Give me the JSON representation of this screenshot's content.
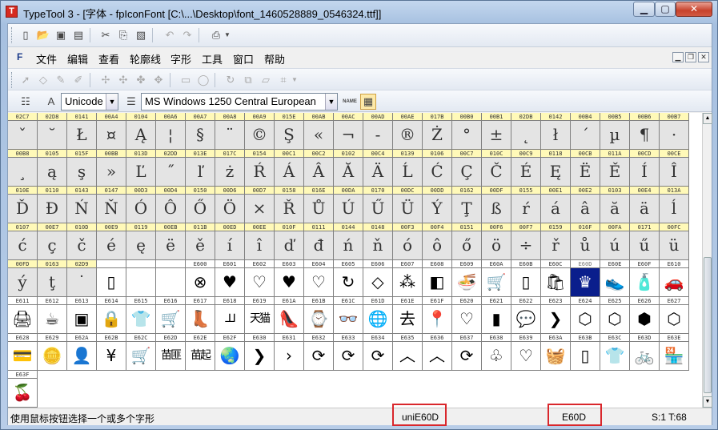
{
  "window": {
    "title": "TypeTool 3 - [字体 - fpIconFont [C:\\...\\Desktop\\font_1460528889_0546324.ttf]]",
    "app_icon": "typetool-app-icon",
    "minimize_icon": "minimize-icon",
    "maximize_icon": "maximize-icon",
    "close_icon": "close-icon"
  },
  "menu": {
    "items": [
      "文件",
      "编辑",
      "查看",
      "轮廓线",
      "字形",
      "工具",
      "窗口",
      "帮助"
    ]
  },
  "toolbar": {
    "encoding_value": "Unicode",
    "codepage_value": "MS Windows 1250 Central European",
    "name_button_label": "NAME"
  },
  "glyph_grid": {
    "rows": [
      [
        [
          "02C7",
          "ˇ"
        ],
        [
          "02D8",
          "˘"
        ],
        [
          "0141",
          "Ł"
        ],
        [
          "00A4",
          "¤"
        ],
        [
          "0104",
          "Ą"
        ],
        [
          "00A6",
          "¦"
        ],
        [
          "00A7",
          "§"
        ],
        [
          "00A8",
          "¨"
        ],
        [
          "00A9",
          "©"
        ],
        [
          "015E",
          "Ş"
        ],
        [
          "00AB",
          "«"
        ],
        [
          "00AC",
          "¬"
        ],
        [
          "00AD",
          "-"
        ],
        [
          "00AE",
          "®"
        ],
        [
          "017B",
          "Ż"
        ],
        [
          "00B0",
          "°"
        ],
        [
          "00B1",
          "±"
        ],
        [
          "02DB",
          "˛"
        ],
        [
          "0142",
          "ł"
        ],
        [
          "00B4",
          "´"
        ],
        [
          "00B5",
          "µ"
        ],
        [
          "00B6",
          "¶"
        ],
        [
          "00B7",
          "·"
        ]
      ],
      [
        [
          "00B8",
          "¸"
        ],
        [
          "0105",
          "ą"
        ],
        [
          "015F",
          "ş"
        ],
        [
          "00BB",
          "»"
        ],
        [
          "013D",
          "Ľ"
        ],
        [
          "02DD",
          "˝"
        ],
        [
          "013E",
          "ľ"
        ],
        [
          "017C",
          "ż"
        ],
        [
          "0154",
          "Ŕ"
        ],
        [
          "00C1",
          "Á"
        ],
        [
          "00C2",
          "Â"
        ],
        [
          "0102",
          "Ă"
        ],
        [
          "00C4",
          "Ä"
        ],
        [
          "0139",
          "Ĺ"
        ],
        [
          "0106",
          "Ć"
        ],
        [
          "00C7",
          "Ç"
        ],
        [
          "010C",
          "Č"
        ],
        [
          "00C9",
          "É"
        ],
        [
          "0118",
          "Ę"
        ],
        [
          "00CB",
          "Ë"
        ],
        [
          "011A",
          "Ě"
        ],
        [
          "00CD",
          "Í"
        ],
        [
          "00CE",
          "Î"
        ]
      ],
      [
        [
          "010E",
          "Ď"
        ],
        [
          "0110",
          "Đ"
        ],
        [
          "0143",
          "Ń"
        ],
        [
          "0147",
          "Ň"
        ],
        [
          "00D3",
          "Ó"
        ],
        [
          "00D4",
          "Ô"
        ],
        [
          "0150",
          "Ő"
        ],
        [
          "00D6",
          "Ö"
        ],
        [
          "00D7",
          "×"
        ],
        [
          "0158",
          "Ř"
        ],
        [
          "016E",
          "Ů"
        ],
        [
          "00DA",
          "Ú"
        ],
        [
          "0170",
          "Ű"
        ],
        [
          "00DC",
          "Ü"
        ],
        [
          "00DD",
          "Ý"
        ],
        [
          "0162",
          "Ţ"
        ],
        [
          "00DF",
          "ß"
        ],
        [
          "0155",
          "ŕ"
        ],
        [
          "00E1",
          "á"
        ],
        [
          "00E2",
          "â"
        ],
        [
          "0103",
          "ă"
        ],
        [
          "00E4",
          "ä"
        ],
        [
          "013A",
          "ĺ"
        ]
      ],
      [
        [
          "0107",
          "ć"
        ],
        [
          "00E7",
          "ç"
        ],
        [
          "010D",
          "č"
        ],
        [
          "00E9",
          "é"
        ],
        [
          "0119",
          "ę"
        ],
        [
          "00EB",
          "ë"
        ],
        [
          "011B",
          "ě"
        ],
        [
          "00ED",
          "í"
        ],
        [
          "00EE",
          "î"
        ],
        [
          "010F",
          "ď"
        ],
        [
          "0111",
          "đ"
        ],
        [
          "0144",
          "ń"
        ],
        [
          "0148",
          "ň"
        ],
        [
          "00F3",
          "ó"
        ],
        [
          "00F4",
          "ô"
        ],
        [
          "0151",
          "ő"
        ],
        [
          "00F6",
          "ö"
        ],
        [
          "00F7",
          "÷"
        ],
        [
          "0159",
          "ř"
        ],
        [
          "016F",
          "ů"
        ],
        [
          "00FA",
          "ú"
        ],
        [
          "0171",
          "ű"
        ],
        [
          "00FC",
          "ü"
        ]
      ],
      [
        [
          "00FD",
          "ý"
        ],
        [
          "0163",
          "ţ"
        ],
        [
          "02D9",
          "˙"
        ],
        [
          "",
          "▯"
        ],
        [
          "",
          ""
        ],
        [
          "",
          ""
        ],
        [
          "E600",
          "⊗"
        ],
        [
          "E601",
          "♥"
        ],
        [
          "E602",
          "♡"
        ],
        [
          "E603",
          "♥"
        ],
        [
          "E604",
          "♡"
        ],
        [
          "E605",
          "↻"
        ],
        [
          "E606",
          "◇"
        ],
        [
          "E607",
          "⁂"
        ],
        [
          "E608",
          "◧"
        ],
        [
          "E609",
          "🍜"
        ],
        [
          "E60A",
          "🛒"
        ],
        [
          "E60B",
          "▯"
        ],
        [
          "E60C",
          "🛍"
        ],
        [
          "E60D",
          "♛"
        ],
        [
          "E60E",
          "👟"
        ],
        [
          "E60F",
          "🧴"
        ],
        [
          "E610",
          "🚗"
        ]
      ],
      [
        [
          "E611",
          "🖨"
        ],
        [
          "E612",
          "☕"
        ],
        [
          "E613",
          "▣"
        ],
        [
          "E614",
          "🔒"
        ],
        [
          "E615",
          "👕"
        ],
        [
          "E616",
          "🛒"
        ],
        [
          "E617",
          "👢"
        ],
        [
          "E618",
          "⅃⅃"
        ],
        [
          "E619",
          "天猫"
        ],
        [
          "E61A",
          "👠"
        ],
        [
          "E61B",
          "⌚"
        ],
        [
          "E61C",
          "👓"
        ],
        [
          "E61D",
          "🌐"
        ],
        [
          "E61E",
          "去"
        ],
        [
          "E61F",
          "📍"
        ],
        [
          "E620",
          "♡"
        ],
        [
          "E621",
          "▮"
        ],
        [
          "E622",
          "💬"
        ],
        [
          "E623",
          "❯"
        ],
        [
          "E624",
          "⬡"
        ],
        [
          "E625",
          "⬡"
        ],
        [
          "E626",
          "⬢"
        ],
        [
          "E627",
          "⬡"
        ]
      ],
      [
        [
          "E628",
          "💳"
        ],
        [
          "E629",
          "🪙"
        ],
        [
          "E62A",
          "👤"
        ],
        [
          "E62B",
          "¥"
        ],
        [
          "E62C",
          "🛒"
        ],
        [
          "E62D",
          "苗匪"
        ],
        [
          "E62E",
          "苗起"
        ],
        [
          "E62F",
          "🌏"
        ],
        [
          "E630",
          "❯"
        ],
        [
          "E631",
          "›"
        ],
        [
          "E632",
          "⟳"
        ],
        [
          "E633",
          "⟳"
        ],
        [
          "E634",
          "⟳"
        ],
        [
          "E635",
          "︿"
        ],
        [
          "E636",
          "︿"
        ],
        [
          "E637",
          "⟳"
        ],
        [
          "E638",
          "♧"
        ],
        [
          "E639",
          "♡"
        ],
        [
          "E63A",
          "🧺"
        ],
        [
          "E63B",
          "▯"
        ],
        [
          "E63C",
          "👕"
        ],
        [
          "E63D",
          "🚲"
        ],
        [
          "E63E",
          "🏪"
        ]
      ],
      [
        [
          "E63F",
          "🍒"
        ]
      ]
    ],
    "selected_code": "E60D"
  },
  "status": {
    "hint": "使用鼠标按钮选择一个或多个字形",
    "glyph_name": "uniE60D",
    "unicode": "E60D",
    "scale": "S:1 T:68"
  },
  "colors": {
    "highlight_box": "#d9272c",
    "selection": "#0a1e8c",
    "code_header": "#fff9b8"
  }
}
